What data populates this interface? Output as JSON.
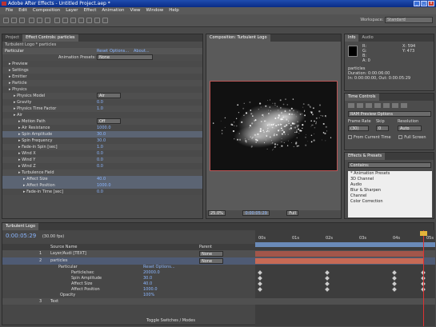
{
  "window": {
    "title": "Adobe After Effects - Untitled Project.aep *"
  },
  "menu": [
    "File",
    "Edit",
    "Composition",
    "Layer",
    "Effect",
    "Animation",
    "View",
    "Window",
    "Help"
  ],
  "workspace": {
    "label": "Workspace:",
    "value": "Standard"
  },
  "effect_controls": {
    "tabs": [
      "Project",
      "Effect Controls: particles"
    ],
    "header": "Turbulent Logo * particles",
    "effect_name": "Particular",
    "reset": "Reset",
    "options": "Options...",
    "about": "About...",
    "anim_presets_label": "Animation Presets:",
    "anim_presets_value": "None",
    "rows": [
      {
        "indent": 1,
        "label": "Preview",
        "value": ""
      },
      {
        "indent": 1,
        "label": "Settings",
        "value": ""
      },
      {
        "indent": 1,
        "label": "Emitter",
        "value": ""
      },
      {
        "indent": 1,
        "label": "Particle",
        "value": ""
      },
      {
        "indent": 1,
        "label": "Physics",
        "value": ""
      },
      {
        "indent": 2,
        "label": "Physics Model",
        "value": "Air",
        "dropdown": true
      },
      {
        "indent": 2,
        "label": "Gravity",
        "value": "0.0"
      },
      {
        "indent": 2,
        "label": "Physics Time Factor",
        "value": "1.0"
      },
      {
        "indent": 2,
        "label": "Air",
        "value": ""
      },
      {
        "indent": 3,
        "label": "Motion Path",
        "value": "Off",
        "dropdown": true
      },
      {
        "indent": 3,
        "label": "Air Resistance",
        "value": "1000.0"
      },
      {
        "indent": 3,
        "label": "Spin Amplitude",
        "value": "30.0"
      },
      {
        "indent": 3,
        "label": "Spin Frequency",
        "value": "30.0"
      },
      {
        "indent": 3,
        "label": "Fade-in Spin [sec]",
        "value": "1.0"
      },
      {
        "indent": 3,
        "label": "Wind X",
        "value": "0.0"
      },
      {
        "indent": 3,
        "label": "Wind Y",
        "value": "0.0"
      },
      {
        "indent": 3,
        "label": "Wind Z",
        "value": "0.0"
      },
      {
        "indent": 3,
        "label": "Turbulence Field",
        "value": ""
      },
      {
        "indent": 4,
        "label": "Affect Size",
        "value": "40.0"
      },
      {
        "indent": 4,
        "label": "Affect Position",
        "value": "1000.0"
      },
      {
        "indent": 4,
        "label": "Fade-in Time [sec]",
        "value": "0.0"
      }
    ]
  },
  "composition": {
    "tab": "Composition: Turbulent Logo",
    "zoom": "25.0%",
    "time": "0:00:05:29",
    "quality": "Full"
  },
  "info": {
    "tabs": [
      "Info",
      "Audio"
    ],
    "R": "R:",
    "G": "G:",
    "B": "B:",
    "A": "A: 0",
    "X": "X: 594",
    "Y": "Y: 473",
    "name": "particles",
    "duration": "Duration: 0:00:06:00",
    "in_out": "In: 0:00:00:00, Out: 0:00:05:29"
  },
  "time_controls": {
    "title": "Time Controls",
    "ram": "RAM Preview Options",
    "frame_rate_label": "Frame Rate",
    "skip_label": "Skip",
    "resolution_label": "Resolution",
    "frame_rate": "(30)",
    "skip": "0",
    "resolution": "Auto",
    "from_current": "From Current Time",
    "full_screen": "Full Screen"
  },
  "effects_presets": {
    "title": "Effects & Presets",
    "search": "Contains:",
    "items": [
      "* Animation Presets",
      "3D Channel",
      "Audio",
      "Blur & Sharpen",
      "Channel",
      "Color Correction"
    ]
  },
  "timeline": {
    "tab": "Turbulent Logo",
    "timecode": "0:00:05:29",
    "fps": "(30.00 fps)",
    "columns": [
      "Source Name",
      "Parent"
    ],
    "ruler": [
      "00s",
      "01s",
      "02s",
      "03s",
      "04s",
      "05s"
    ],
    "layers": [
      {
        "num": "1",
        "name": "Layer/Audi [TEXT]",
        "parent": "None",
        "type": "layer"
      },
      {
        "num": "2",
        "name": "particles",
        "parent": "None",
        "type": "layer"
      }
    ],
    "props": [
      {
        "label": "Particular",
        "value": "Reset Options..."
      },
      {
        "label": "Particle/sec",
        "value": "20000.0"
      },
      {
        "label": "Spin Amplitude",
        "value": "30.0"
      },
      {
        "label": "Affect Size",
        "value": "40.0"
      },
      {
        "label": "Affect Position",
        "value": "1000.0"
      },
      {
        "label": "Opacity",
        "value": "100%"
      }
    ],
    "bottom_layer": {
      "num": "3",
      "name": "Text"
    },
    "toggle": "Toggle Switches / Modes"
  }
}
